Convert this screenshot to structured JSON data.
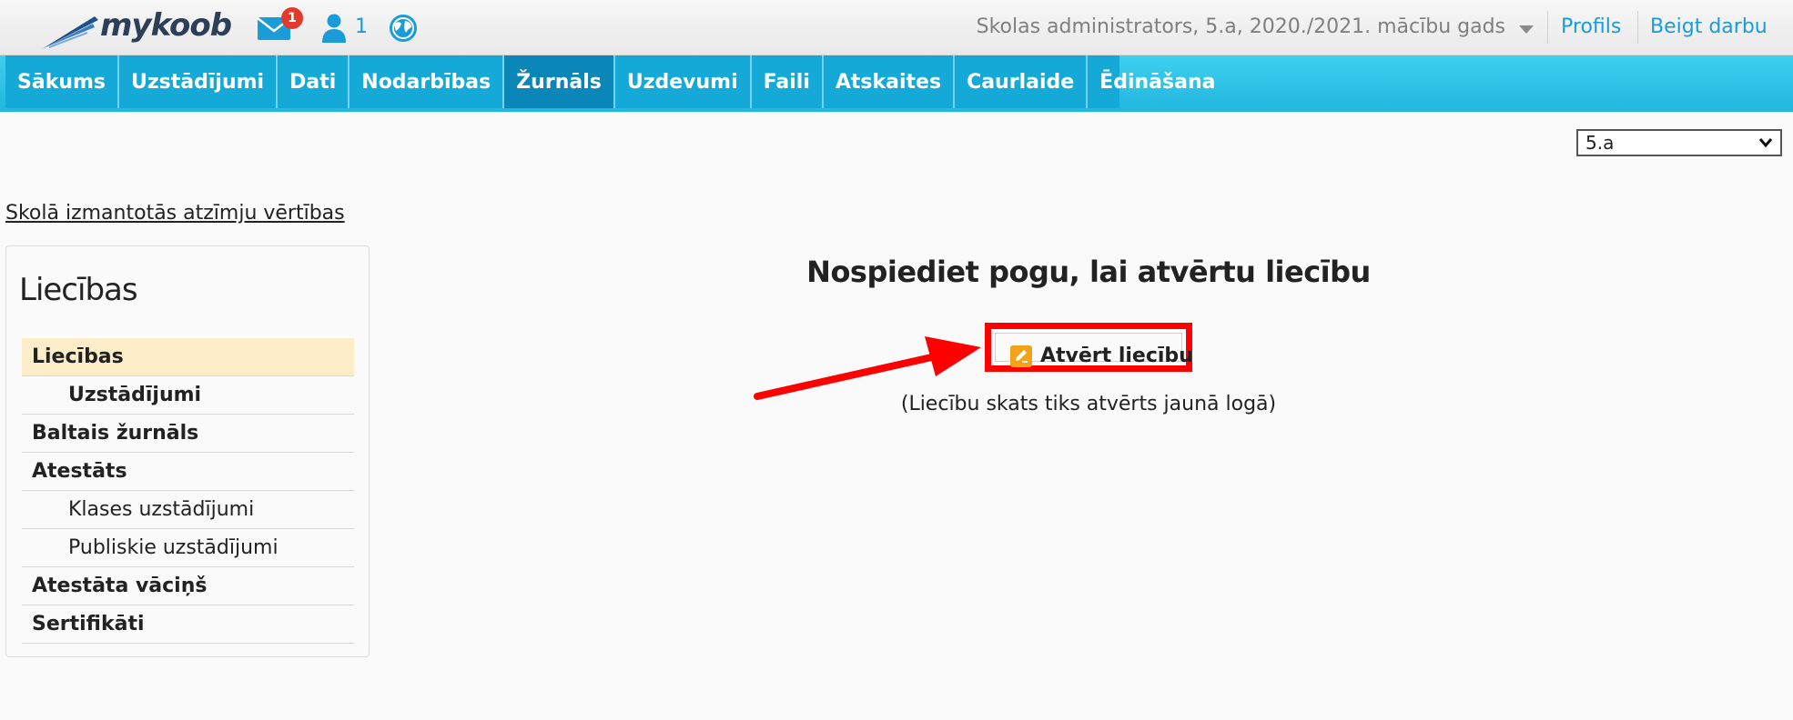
{
  "header": {
    "logo_text": "mykoob",
    "mail_badge": "1",
    "online_users": "1",
    "context": "Skolas administrators, 5.a, 2020./2021. mācību gads",
    "links": {
      "profile": "Profils",
      "logout": "Beigt darbu"
    },
    "icons": [
      "mail-icon",
      "user-icon",
      "globe-icon",
      "caret-down-icon"
    ]
  },
  "nav": {
    "items": [
      "Sākums",
      "Uzstādījumi",
      "Dati",
      "Nodarbības",
      "Žurnāls",
      "Uzdevumi",
      "Faili",
      "Atskaites",
      "Caurlaide",
      "Ēdināšana"
    ],
    "active": "Žurnāls"
  },
  "class_select": {
    "value": "5.a"
  },
  "grades_link": "Skolā izmantotās atzīmju vērtības",
  "sidebar": {
    "title": "Liecības",
    "items": [
      {
        "label": "Liecības",
        "bold": true,
        "indent": false,
        "selected": true
      },
      {
        "label": "Uzstādījumi",
        "bold": true,
        "indent": true,
        "selected": false
      },
      {
        "label": "Baltais žurnāls",
        "bold": true,
        "indent": false,
        "selected": false
      },
      {
        "label": "Atestāts",
        "bold": true,
        "indent": false,
        "selected": false
      },
      {
        "label": "Klases uzstādījumi",
        "bold": false,
        "indent": true,
        "selected": false
      },
      {
        "label": "Publiskie uzstādījumi",
        "bold": false,
        "indent": true,
        "selected": false
      },
      {
        "label": "Atestāta vāciņš",
        "bold": true,
        "indent": false,
        "selected": false
      },
      {
        "label": "Sertifikāti",
        "bold": true,
        "indent": false,
        "selected": false
      }
    ]
  },
  "main": {
    "headline": "Nospiediet pogu, lai atvērtu liecību",
    "button_label": "Atvērt liecību",
    "note": "(Liecību skats tiks atvērts jaunā logā)"
  },
  "colors": {
    "nav_bg": "#15a9d8",
    "nav_active": "#0b86b8",
    "link": "#1a9cd8",
    "highlight_box": "#ff0000",
    "selected_row": "#fdedc9"
  }
}
